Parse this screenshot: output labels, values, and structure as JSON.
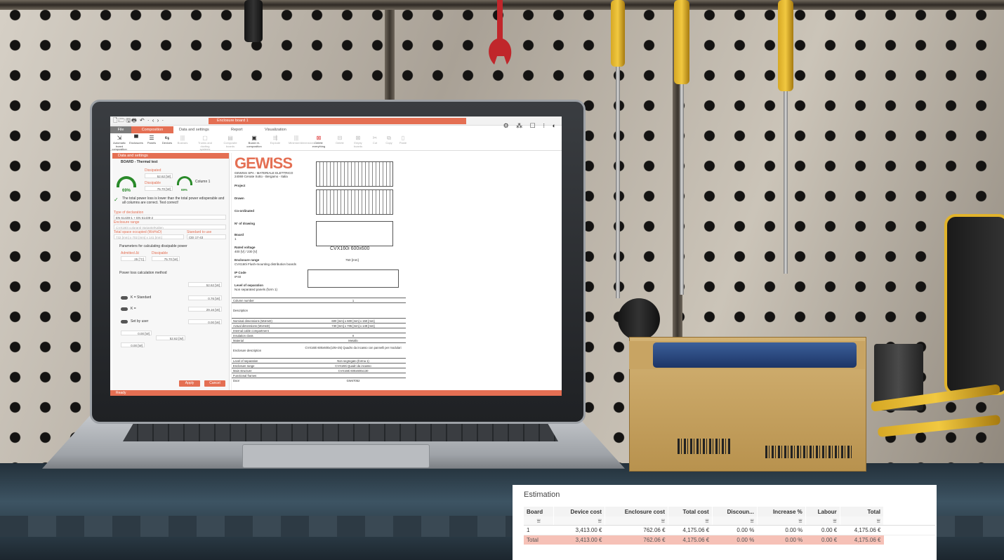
{
  "app": {
    "document_tab": "Enclosure board 1",
    "quick_access_icons": "🗋🗁🖫🖶 ↶ · ‹ › ·",
    "right_toolbar_icons": "⚙ ⁂ ☐ ⁝ ◐"
  },
  "menu": {
    "file": "File",
    "composition": "Composition",
    "data_settings": "Data and settings",
    "report": "Report",
    "visualization": "Visualization"
  },
  "ribbon": [
    {
      "label": "Automatic board composition",
      "icon": "⇲"
    },
    {
      "label": "Enclosures",
      "icon": "▀"
    },
    {
      "label": "Panels",
      "icon": "☰"
    },
    {
      "label": "Devices",
      "icon": "⇆"
    },
    {
      "label": "Busbars",
      "icon": "|||"
    },
    {
      "label": "Trunks and ducting systems",
      "icon": "▢"
    },
    {
      "label": "Composite boards",
      "icon": "▤"
    },
    {
      "label": "Board re-composition",
      "icon": "▣"
    },
    {
      "label": "Explode",
      "icon": "⇶"
    },
    {
      "label": "Minimize/dimensions",
      "icon": "|||"
    },
    {
      "label": "Delete everything",
      "icon": "⊠"
    },
    {
      "label": "Delete",
      "icon": "⊟"
    },
    {
      "label": "Empty boards",
      "icon": "⊠"
    },
    {
      "label": "Cut",
      "icon": "✂"
    },
    {
      "label": "Copy",
      "icon": "⧉"
    },
    {
      "label": "Paste",
      "icon": "▯"
    }
  ],
  "panel": {
    "header": "Data and settings",
    "board": "BOARD - Thermal test",
    "gauge1": "69%",
    "gauge2": "69%",
    "column_label": "Column 1",
    "dissipated_label": "Dissipated",
    "dissipated_val": "52.62 [W]",
    "dissipable_label": "Dissipable",
    "dissipable_val": "76.70 [W]",
    "test_message": "The total power loss is lower than the total power edisperable and all columns are correct. Test correct!",
    "type_decl_label": "Type of declaration",
    "type_decl_val": "EN 61439-1 + EN 61439-2",
    "enclosure_range_label": "Enclosure range",
    "enclosure_range_val": "CVX160i coloranti Variante/Kalten",
    "total_space_label": "Total space occupied (WxHxD)",
    "total_space_val": "732 [mm] x 702 [mm] x 141 [mm]",
    "standard_label": "Standard to use",
    "standard_val": "CEI 17-43",
    "params_title": "Parameters for calculating dissipable power",
    "admitted_label": "Admitted Δt",
    "admitted_val": "25 [°C]",
    "dissipable2_val": "75.70 [W]",
    "loss_title": "Power loss calculation method",
    "k_standard": "K = Standard",
    "k_plain": "K =",
    "set_by_user": "Set by user",
    "k_val1": "52.62 [W]",
    "k_val2": "0.76 [W]",
    "k_val3": "29.16 [W]",
    "k_val4": "0.00 [W]",
    "enclosure_val": "0.00 [W]",
    "dissipated3_val": "52.62 [W]",
    "additional_val": "0.00 [W]",
    "apply": "Apply",
    "cancel": "Cancel"
  },
  "sheet": {
    "logo": "GEWISS",
    "company": "GEWISS SPA - MATERIALE ELETTRICO",
    "address": "24069 Cenate Sotto - Bergamo - Italia",
    "fields": [
      {
        "label": "Project",
        "value": ""
      },
      {
        "label": "Drawn",
        "value": ""
      },
      {
        "label": "Co-ordinated",
        "value": ""
      },
      {
        "label": "N° of drawing",
        "value": ""
      },
      {
        "label": "Board",
        "value": "1"
      },
      {
        "label": "Rated voltage",
        "value": "400 [V] / 230 [V]"
      },
      {
        "label": "Enclosure range",
        "value": "CVX160i Flush-mounting distribution boards"
      },
      {
        "label": "IP Code",
        "value": "IP40"
      },
      {
        "label": "Level of separation",
        "value": "Non separated panels (form 1)"
      }
    ],
    "drawing_caption": "CVX160i   600x600",
    "width_dim": "750 [mm]",
    "table": [
      {
        "label": "Column number",
        "value": "1"
      },
      {
        "label": "Description",
        "value": ""
      },
      {
        "label": "Nominal dimensions (WxHxD)",
        "value": "600 [mm] x 600 [mm] x 150 [mm]"
      },
      {
        "label": "Actual dimensions (WxHxD)",
        "value": "730 [mm] x 705 [mm] x 149 [mm]"
      },
      {
        "label": "Internal cable compartment",
        "value": ""
      },
      {
        "label": "Insulation class",
        "value": "II"
      },
      {
        "label": "Material",
        "value": "Metallo"
      },
      {
        "label": "Enclosure description",
        "value": "CVX160i 600x600x(105+25) Quadro da incasso con pannelli per modulari"
      },
      {
        "label": "Level of separation",
        "value": "Non segregato (forma 1)"
      },
      {
        "label": "Enclosure range",
        "value": "CVX160i Quadri da incasso"
      },
      {
        "label": "Main structure",
        "value": "CVX160i 600x600x130"
      },
      {
        "label": "Functional frames",
        "value": ""
      },
      {
        "label": "Door",
        "value": "GW47052"
      }
    ]
  },
  "status": "Ready",
  "estimation": {
    "title": "Estimation",
    "columns": [
      "Board",
      "Device cost",
      "Enclosure cost",
      "Total cost",
      "Discoun...",
      "Increase %",
      "Labour",
      "Total"
    ],
    "rows": [
      [
        "1",
        "3,413.00 €",
        "762.06 €",
        "4,175.06 €",
        "0.00 %",
        "0.00 %",
        "0.00 €",
        "4,175.06 €"
      ]
    ],
    "total_row": [
      "Total",
      "3,413.00 €",
      "762.06 €",
      "4,175.06 €",
      "0.00 %",
      "0.00 %",
      "0.00 €",
      "4,175.06 €"
    ],
    "filter_icon": "⩸"
  }
}
